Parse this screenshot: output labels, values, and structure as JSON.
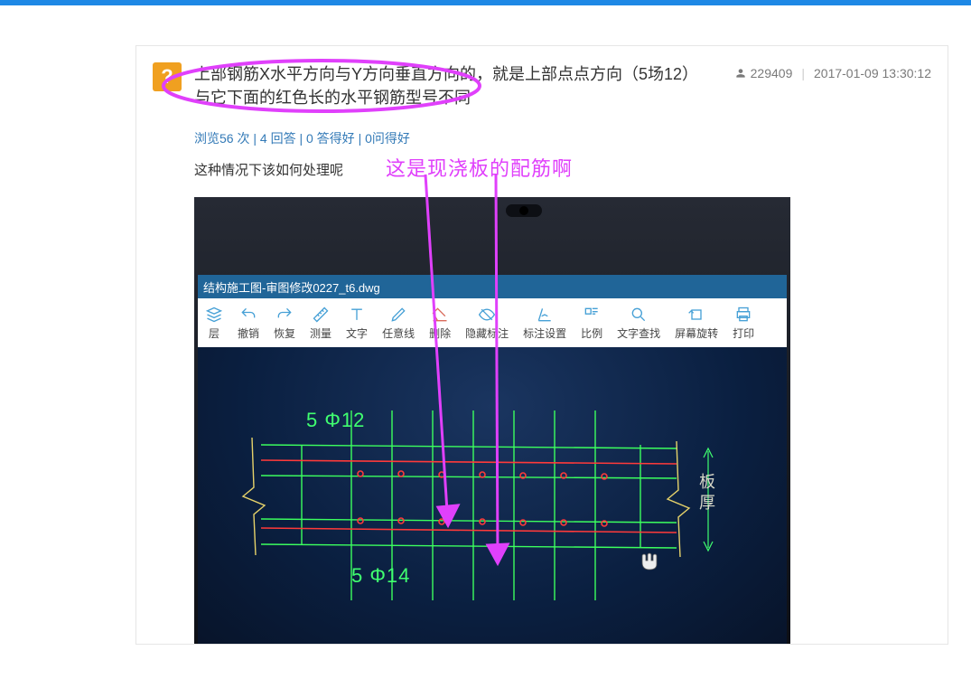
{
  "post": {
    "title_line1": "上部钢筋X水平方向与Y方向垂直方向的，就是上部点点方向（5场12）",
    "title_line2": "与它下面的红色长的水平钢筋型号不同",
    "author": "229409",
    "time": "2017-01-09 13:30:12",
    "stats": {
      "views": "浏览56 次",
      "answers": "4 回答",
      "good_a": "0 答得好",
      "good_q": "0问得好"
    },
    "body": "这种情况下该如何处理呢",
    "annotation": "这是现浇板的配筋啊"
  },
  "cad": {
    "filename": "结构施工图-审图修改0227_t6.dwg",
    "toolbar": [
      {
        "icon": "layers",
        "label": "层"
      },
      {
        "icon": "undo",
        "label": "撤销"
      },
      {
        "icon": "redo",
        "label": "恢复"
      },
      {
        "icon": "ruler",
        "label": "测量"
      },
      {
        "icon": "text",
        "label": "文字"
      },
      {
        "icon": "pencil",
        "label": "任意线"
      },
      {
        "icon": "eraser",
        "label": "删除"
      },
      {
        "icon": "hide",
        "label": "隐藏标注"
      },
      {
        "icon": "dim",
        "label": "标注设置"
      },
      {
        "icon": "ratio",
        "label": "比例"
      },
      {
        "icon": "find",
        "label": "文字查找"
      },
      {
        "icon": "rotate",
        "label": "屏幕旋转"
      },
      {
        "icon": "print",
        "label": "打印"
      }
    ],
    "labels": {
      "top": "5 Φ12",
      "bottom": "5 Φ14",
      "side": "板厚"
    }
  }
}
